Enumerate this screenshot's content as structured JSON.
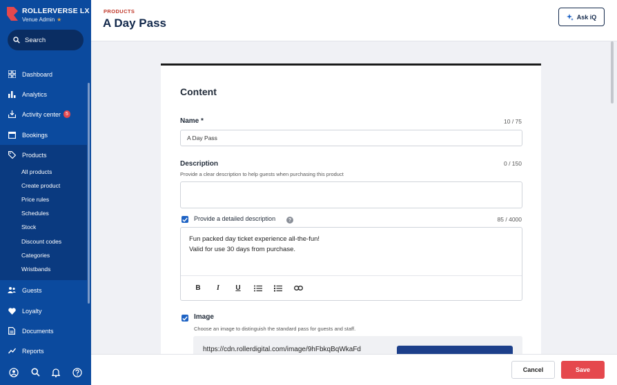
{
  "brand": {
    "name": "ROLLERVERSE LX",
    "role": "Venue Admin"
  },
  "search": {
    "label": "Search"
  },
  "nav": {
    "dashboard": "Dashboard",
    "analytics": "Analytics",
    "activity_center": "Activity center",
    "activity_badge": "5",
    "bookings": "Bookings",
    "products": "Products",
    "guests": "Guests",
    "loyalty": "Loyalty",
    "documents": "Documents",
    "reports": "Reports"
  },
  "products_sub": [
    "All products",
    "Create product",
    "Price rules",
    "Schedules",
    "Stock",
    "Discount codes",
    "Categories",
    "Wristbands"
  ],
  "header": {
    "eyebrow": "PRODUCTS",
    "title": "A Day Pass",
    "ask_label": "Ask iQ"
  },
  "content": {
    "section_title": "Content",
    "name_label": "Name *",
    "name_counter": "10 / 75",
    "name_value": "A Day Pass",
    "description_label": "Description",
    "description_counter": "0 / 150",
    "description_help": "Provide a clear description to help guests when purchasing this product",
    "detailed_label": "Provide a detailed description",
    "detailed_counter": "85 / 4000",
    "detailed_line1": "Fun packed day ticket experience all-the-fun!",
    "detailed_line2": "Valid for use 30 days from purchase.",
    "image_label": "Image",
    "image_help": "Choose an image to distinguish the standard pass for guests and staff.",
    "image_url": "https://cdn.rollerdigital.com/image/9hFbkqBqWkaFd"
  },
  "footer": {
    "cancel_label": "Cancel",
    "save_label": "Save"
  },
  "colors": {
    "sidebar": "#0b4a9e",
    "accent": "#e5484d",
    "checkbox": "#1e63c4",
    "title": "#12284b"
  }
}
